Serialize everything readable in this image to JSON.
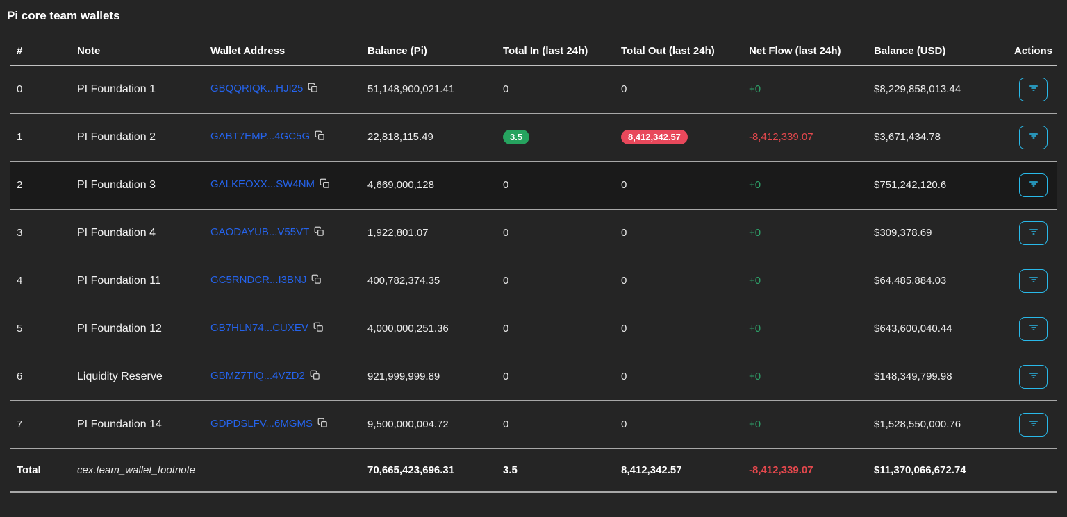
{
  "page": {
    "title": "Pi core team wallets"
  },
  "colors": {
    "accent": "#29b9e9",
    "link": "#2563eb",
    "badge-green": "#26a35f",
    "badge-red": "#e8485b",
    "pos": "#2ea36a",
    "neg": "#e5484d"
  },
  "table": {
    "columns": [
      "#",
      "Note",
      "Wallet Address",
      "Balance (Pi)",
      "Total In (last 24h)",
      "Total Out (last 24h)",
      "Net Flow (last 24h)",
      "Balance (USD)",
      "Actions"
    ],
    "rows": [
      {
        "index": "0",
        "note": "PI Foundation 1",
        "wallet": "GBQQRIQK...HJI25",
        "balance_pi": "51,148,900,021.41",
        "total_in": "0",
        "in_badge": false,
        "total_out": "0",
        "out_badge": false,
        "net_flow": "+0",
        "net_positive": true,
        "balance_usd": "$8,229,858,013.44",
        "dimmed": false
      },
      {
        "index": "1",
        "note": "PI Foundation 2",
        "wallet": "GABT7EMP...4GC5G",
        "balance_pi": "22,818,115.49",
        "total_in": "3.5",
        "in_badge": true,
        "total_out": "8,412,342.57",
        "out_badge": true,
        "net_flow": "-8,412,339.07",
        "net_positive": false,
        "balance_usd": "$3,671,434.78",
        "dimmed": false
      },
      {
        "index": "2",
        "note": "PI Foundation 3",
        "wallet": "GALKEOXX...SW4NM",
        "balance_pi": "4,669,000,128",
        "total_in": "0",
        "in_badge": false,
        "total_out": "0",
        "out_badge": false,
        "net_flow": "+0",
        "net_positive": true,
        "balance_usd": "$751,242,120.6",
        "dimmed": true
      },
      {
        "index": "3",
        "note": "PI Foundation 4",
        "wallet": "GAODAYUB...V55VT",
        "balance_pi": "1,922,801.07",
        "total_in": "0",
        "in_badge": false,
        "total_out": "0",
        "out_badge": false,
        "net_flow": "+0",
        "net_positive": true,
        "balance_usd": "$309,378.69",
        "dimmed": false
      },
      {
        "index": "4",
        "note": "PI Foundation 11",
        "wallet": "GC5RNDCR...I3BNJ",
        "balance_pi": "400,782,374.35",
        "total_in": "0",
        "in_badge": false,
        "total_out": "0",
        "out_badge": false,
        "net_flow": "+0",
        "net_positive": true,
        "balance_usd": "$64,485,884.03",
        "dimmed": false
      },
      {
        "index": "5",
        "note": "PI Foundation 12",
        "wallet": "GB7HLN74...CUXEV",
        "balance_pi": "4,000,000,251.36",
        "total_in": "0",
        "in_badge": false,
        "total_out": "0",
        "out_badge": false,
        "net_flow": "+0",
        "net_positive": true,
        "balance_usd": "$643,600,040.44",
        "dimmed": false
      },
      {
        "index": "6",
        "note": "Liquidity Reserve",
        "wallet": "GBMZ7TIQ...4VZD2",
        "balance_pi": "921,999,999.89",
        "total_in": "0",
        "in_badge": false,
        "total_out": "0",
        "out_badge": false,
        "net_flow": "+0",
        "net_positive": true,
        "balance_usd": "$148,349,799.98",
        "dimmed": false
      },
      {
        "index": "7",
        "note": "PI Foundation 14",
        "wallet": "GDPDSLFV...6MGMS",
        "balance_pi": "9,500,000,004.72",
        "total_in": "0",
        "in_badge": false,
        "total_out": "0",
        "out_badge": false,
        "net_flow": "+0",
        "net_positive": true,
        "balance_usd": "$1,528,550,000.76",
        "dimmed": false
      }
    ],
    "total": {
      "label": "Total",
      "footnote": "cex.team_wallet_footnote",
      "balance_pi": "70,665,423,696.31",
      "total_in": "3.5",
      "total_out": "8,412,342.57",
      "net_flow": "-8,412,339.07",
      "balance_usd": "$11,370,066,672.74"
    }
  }
}
